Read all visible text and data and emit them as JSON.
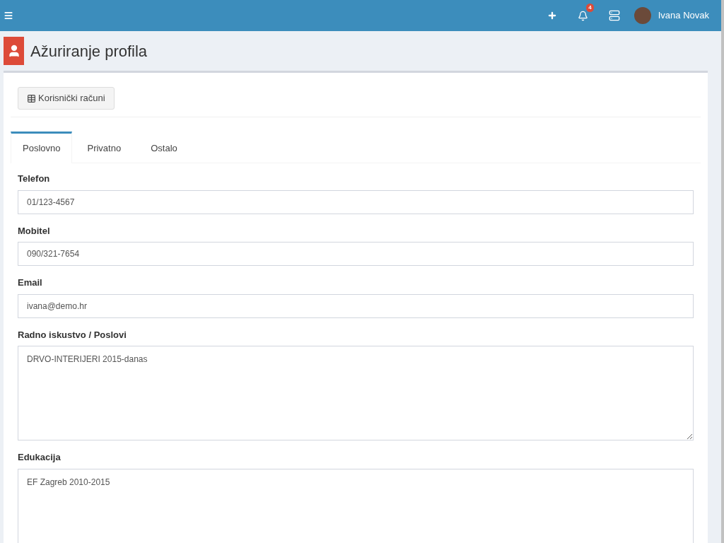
{
  "header": {
    "notification_count": "4",
    "user_name": "Ivana Novak"
  },
  "page_title": "Ažuriranje profila",
  "toolbar_button": "Korisnički računi",
  "tabs": [
    {
      "label": "Poslovno",
      "selected": true
    },
    {
      "label": "Privatno",
      "selected": false
    },
    {
      "label": "Ostalo",
      "selected": false
    }
  ],
  "fields": [
    {
      "label": "Telefon",
      "kind": "input",
      "value": "01/123-4567"
    },
    {
      "label": "Mobitel",
      "kind": "input",
      "value": "090/321-7654"
    },
    {
      "label": "Email",
      "kind": "input",
      "value": "ivana@demo.hr"
    },
    {
      "label": "Radno iskustvo / Poslovi",
      "kind": "textarea",
      "value": "DRVO-INTERIJERI 2015-danas"
    },
    {
      "label": "Edukacija",
      "kind": "textarea",
      "value": "EF Zagreb 2010-2015"
    }
  ]
}
